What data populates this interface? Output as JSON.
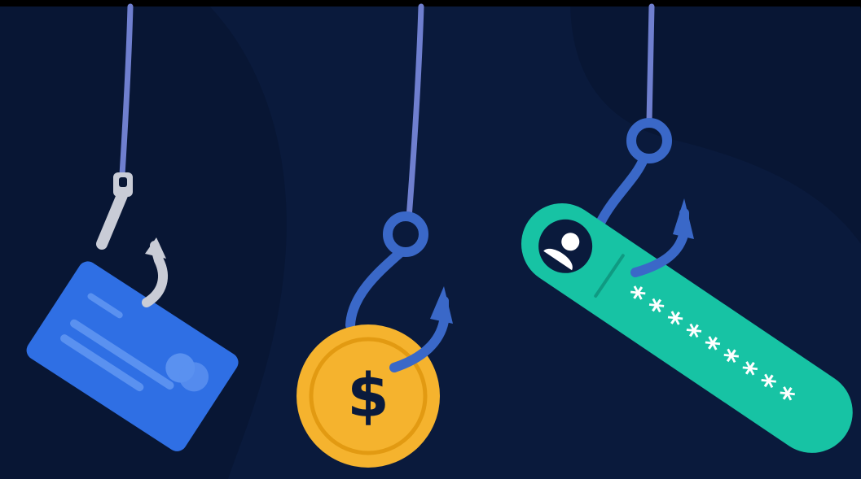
{
  "scene": {
    "description_free": true,
    "colors": {
      "background": "#0a1a3c",
      "blob_dark": "#081634",
      "blob_right": "#0d2250",
      "line": "#6f7fcf",
      "hook_silver": "#c9ccd6",
      "hook_blue": "#3a68c8",
      "card": "#2f6fe4",
      "card_stripe": "#5a91f0",
      "coin": "#f5b32e",
      "coin_inner": "#e29a12",
      "coin_symbol": "#0a1a3c",
      "password_bar": "#17c3a4",
      "password_dots": "#ffffff"
    }
  },
  "coin": {
    "symbol": "$"
  },
  "password_field": {
    "mask": "*********"
  },
  "icons": {
    "card": "credit-card-icon",
    "coin": "dollar-coin-icon",
    "user": "user-avatar-icon"
  }
}
